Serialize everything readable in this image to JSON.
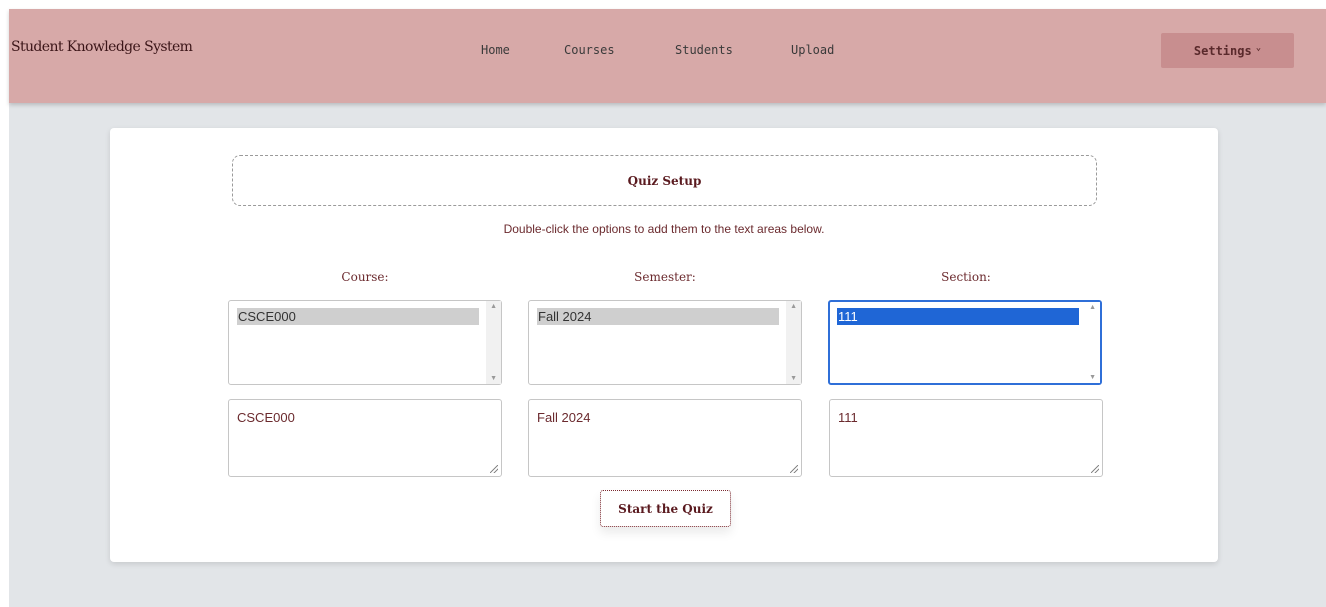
{
  "navbar": {
    "brand": "Student Knowledge System",
    "links": [
      "Home",
      "Courses",
      "Students",
      "Upload"
    ],
    "settings_label": "Settings",
    "settings_icon": "chevron-down-icon"
  },
  "quiz_setup": {
    "title": "Quiz Setup",
    "instructions": "Double-click the options to add them to the text areas below.",
    "columns": [
      {
        "label": "Course:",
        "option": "CSCE000",
        "textarea_value": "CSCE000"
      },
      {
        "label": "Semester:",
        "option": "Fall 2024",
        "textarea_value": "Fall 2024"
      },
      {
        "label": "Section:",
        "option": "111",
        "textarea_value": "111"
      }
    ],
    "start_button": "Start the Quiz"
  },
  "colors": {
    "navbar_bg": "#d7a9a8",
    "settings_bg": "#c88e8f",
    "accent_text": "#6b2a2e",
    "selected_option": "#1f66d6",
    "page_bg": "#e2e5e8"
  }
}
